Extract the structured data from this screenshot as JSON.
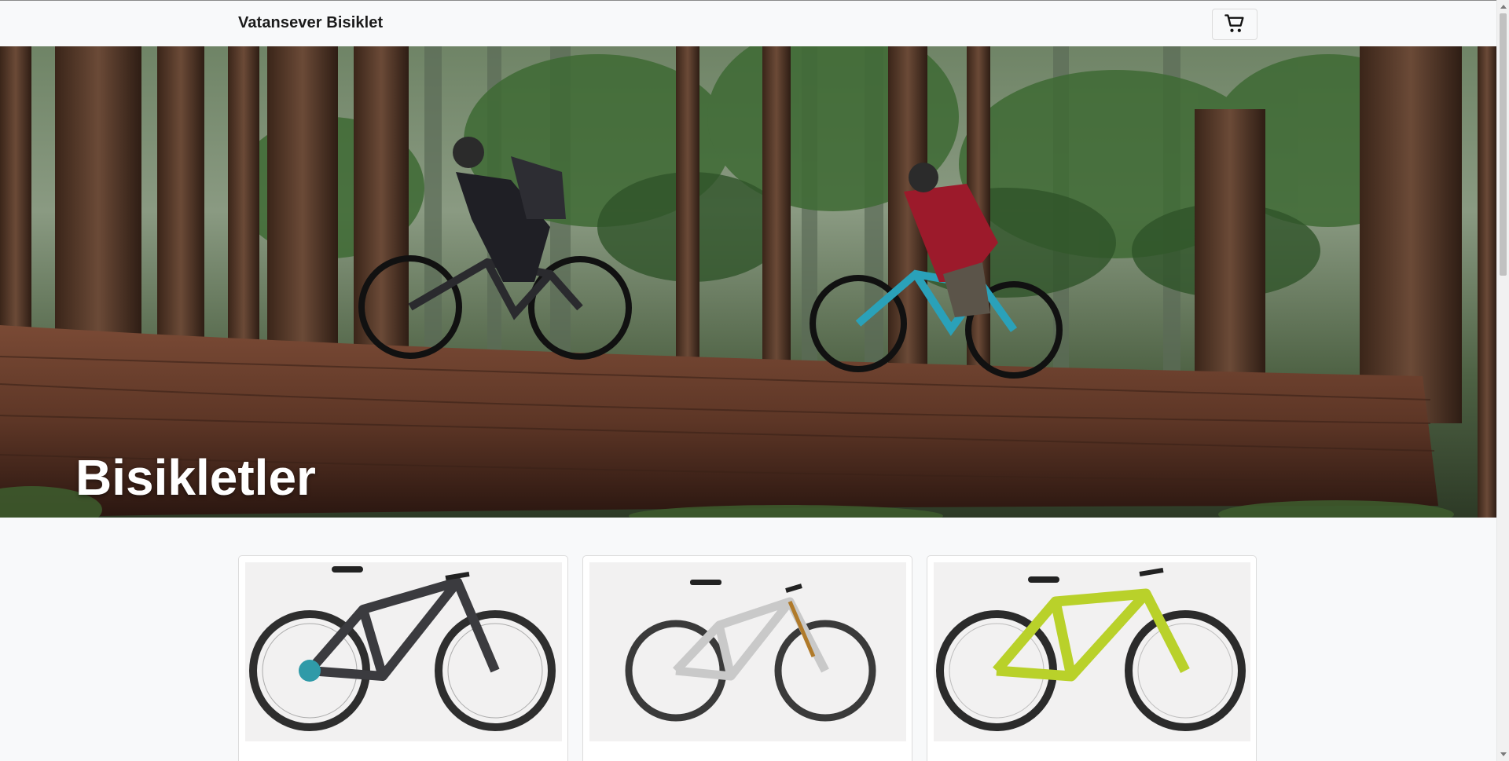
{
  "navbar": {
    "brand": "Vatansever Bisiklet",
    "cart_icon": "shopping-cart-icon"
  },
  "hero": {
    "title": "Bisikletler",
    "image": "forest-riders-on-fallen-log"
  },
  "products": [
    {
      "image": "carbon-full-suspension-mountain-bike",
      "color": "#3b3b3f"
    },
    {
      "image": "white-full-suspension-mountain-bike",
      "color": "#c9c9c9"
    },
    {
      "image": "lime-hardtail-mountain-bike",
      "color": "#b9d12a"
    }
  ],
  "colors": {
    "background": "#f8f9fa",
    "card_border": "#dcdcdc",
    "hero_text": "#ffffff"
  }
}
